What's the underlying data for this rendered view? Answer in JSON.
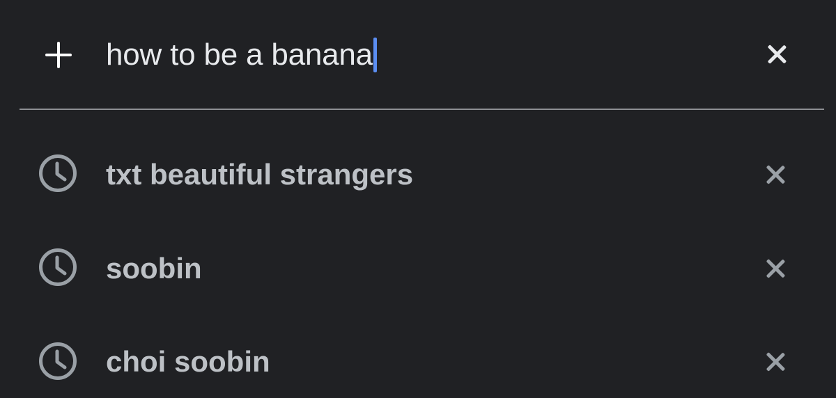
{
  "search": {
    "query": "how to be a banana",
    "add_icon": "plus-icon",
    "clear_icon": "close-icon",
    "caret_color": "#5b8ef2"
  },
  "suggestions": [
    {
      "label": "txt beautiful strangers",
      "icon": "history-icon",
      "remove_icon": "close-icon"
    },
    {
      "label": "soobin",
      "icon": "history-icon",
      "remove_icon": "close-icon"
    },
    {
      "label": "choi soobin",
      "icon": "history-icon",
      "remove_icon": "close-icon"
    }
  ],
  "colors": {
    "background": "#202124",
    "query_text": "#e8eaed",
    "suggestion_text": "#bdc1c6",
    "icon_muted": "#9aa0a6",
    "divider": "#8e9094"
  }
}
